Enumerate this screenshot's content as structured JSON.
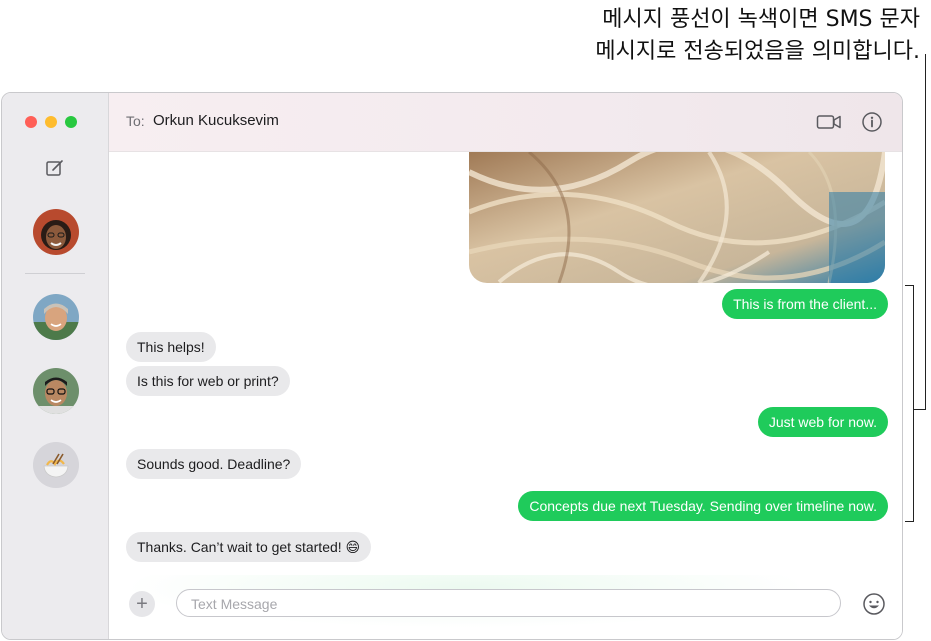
{
  "callout": {
    "line1": "메시지 풍선이 녹색이면 SMS 문자",
    "line2": "메시지로 전송되었음을 의미합니다."
  },
  "sidebar": {
    "compose_icon": "compose-icon",
    "conversations": [
      {
        "avatar": "avatar-photo"
      },
      {
        "avatar": "avatar-photo"
      },
      {
        "avatar": "avatar-photo"
      },
      {
        "avatar": "noodle-emoji"
      }
    ]
  },
  "header": {
    "to_label": "To:",
    "recipient": "Orkun Kucuksevim",
    "video_icon": "video-camera-icon",
    "info_icon": "info-icon"
  },
  "messages": [
    {
      "type": "out",
      "text": "This is from the client..."
    },
    {
      "type": "in",
      "text": "This helps!"
    },
    {
      "type": "in",
      "text": "Is this for web or print?"
    },
    {
      "type": "out",
      "text": "Just web for now."
    },
    {
      "type": "in",
      "text": "Sounds good. Deadline?"
    },
    {
      "type": "out",
      "text": "Concepts due next Tuesday. Sending over timeline now."
    },
    {
      "type": "in",
      "text": "Thanks. Can’t wait to get started! 😄"
    }
  ],
  "compose": {
    "placeholder": "Text Message",
    "add_icon": "plus-icon",
    "emoji_icon": "emoji-icon"
  },
  "colors": {
    "sms_bubble": "#1fcb5b",
    "incoming_bubble": "#e9e9eb",
    "sidebar": "#ecebee"
  }
}
